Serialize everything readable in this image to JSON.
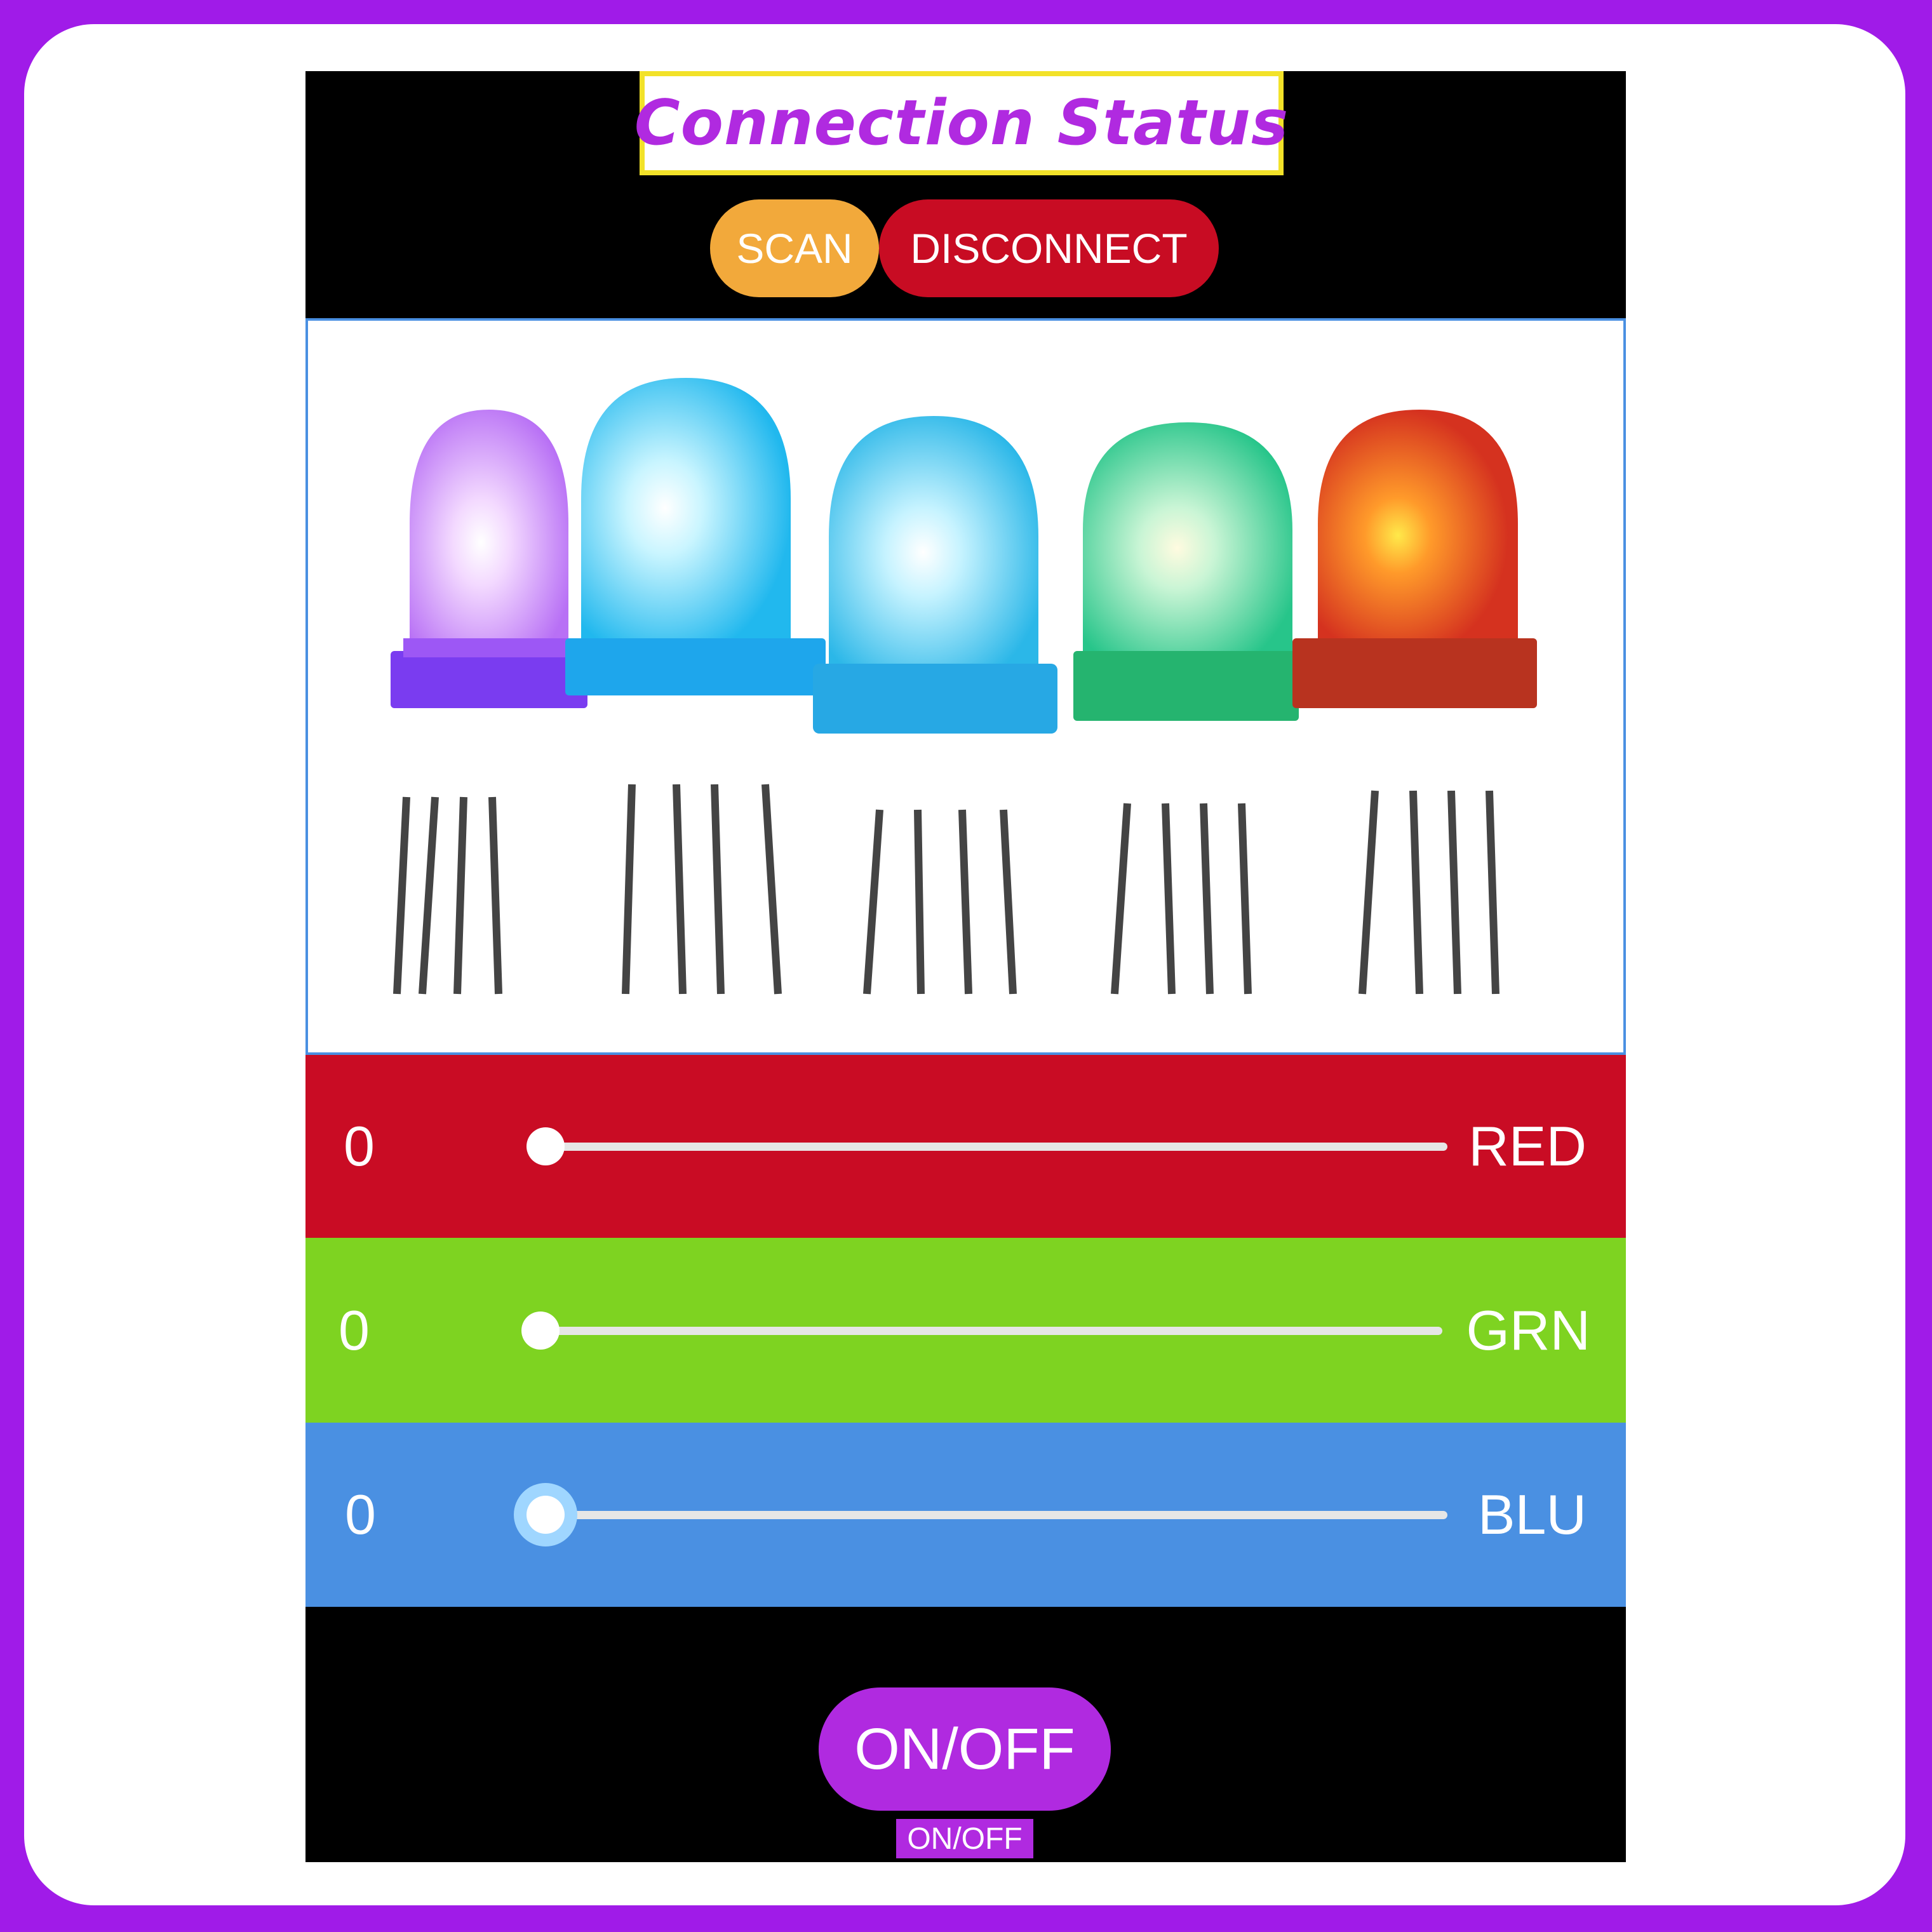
{
  "header": {
    "status_title": "Connection Status"
  },
  "buttons": {
    "scan_label": "SCAN",
    "disconnect_label": "DISCONNECT"
  },
  "image": {
    "subject": "five glowing RGB LEDs",
    "led_colors": [
      "#c77dff",
      "#35c9f2",
      "#3ec4ef",
      "#39d39a",
      "#e8452a"
    ]
  },
  "sliders": [
    {
      "label": "RED",
      "value_text": "0",
      "value": 0,
      "band_color": "#c90c24"
    },
    {
      "label": "GRN",
      "value_text": "0",
      "value": 0,
      "band_color": "#7ed321"
    },
    {
      "label": "BLU",
      "value_text": "0",
      "value": 0,
      "band_color": "#4a90e2"
    }
  ],
  "power": {
    "button_label": "ON/OFF",
    "caption": "ON/OFF"
  },
  "colors": {
    "frame": "#a01be8",
    "accent_purple": "#b02ae0",
    "scan_orange": "#f2a93b",
    "disconnect_red": "#c80c23",
    "title_border_yellow": "#f2e229",
    "background": "#000000"
  }
}
